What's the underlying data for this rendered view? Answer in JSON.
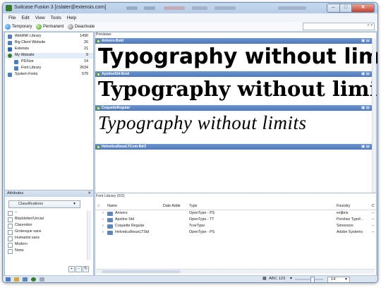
{
  "window": {
    "title": "Suitcase Fusion 3 [cslater@extensis.com]"
  },
  "menu": [
    "File",
    "Edit",
    "View",
    "Tools",
    "Help"
  ],
  "toolbar": {
    "temporary": "Temporary",
    "permanent": "Permanent",
    "deactivate": "Deactivate",
    "search_icon": "⌕ ▾"
  },
  "libraries": [
    {
      "label": "WebINK Library",
      "count": "1490",
      "indent": 0,
      "color": "#4f7bbf"
    },
    {
      "label": "Big Client Website",
      "count": "26",
      "indent": 0,
      "color": "#4f7bbf"
    },
    {
      "label": "Extensis",
      "count": "21",
      "indent": 0,
      "color": "#2f67b2"
    },
    {
      "label": "My Website",
      "count": "9",
      "indent": 0,
      "color": "#3a7a2c",
      "selected": true
    },
    {
      "label": "PDXize",
      "count": "14",
      "indent": 1,
      "color": "#4f7bbf"
    },
    {
      "label": "Font Library",
      "count": "2634",
      "indent": 1,
      "color": "#4f7bbf"
    },
    {
      "label": "System Fonts",
      "count": "579",
      "indent": 0,
      "color": "#4f7bbf"
    }
  ],
  "attributes": {
    "header": "Attributes",
    "close": "✕",
    "dropdown": "Classifications",
    "items": [
      "--",
      "Blackletter/Uncial",
      "Clarendon",
      "Grotesque sans",
      "Humanist sans",
      "Modern",
      "None"
    ],
    "plus": "+",
    "minus": "−"
  },
  "previews": {
    "label": "Previews",
    "sample_text": "Typography without limits",
    "fonts": [
      "Anivers-Bold",
      "ApolineStd-Bold",
      "CoquetteRegular",
      "HelveticaNeueLTCom-BdO"
    ]
  },
  "font_table": {
    "caption": "Font Library (0/2)",
    "columns": [
      "Name",
      "Date Adde",
      "Type",
      "Foundry",
      "C"
    ],
    "rows": [
      {
        "name": "Anivers",
        "type": "OpenType - PS",
        "foundry": "exljbris",
        "c": "--"
      },
      {
        "name": "Apoline Std",
        "type": "OpenType - TT",
        "foundry": "Porshez Typof...",
        "c": "--"
      },
      {
        "name": "Coquette Regular",
        "type": "TrueType",
        "foundry": "Simonson",
        "c": "--"
      },
      {
        "name": "HelveticaNeueLTStd",
        "type": "OpenType - PS",
        "foundry": "Adobe Systems",
        "c": "--"
      }
    ]
  },
  "status": {
    "sample": "ABC 123",
    "size": "14"
  }
}
